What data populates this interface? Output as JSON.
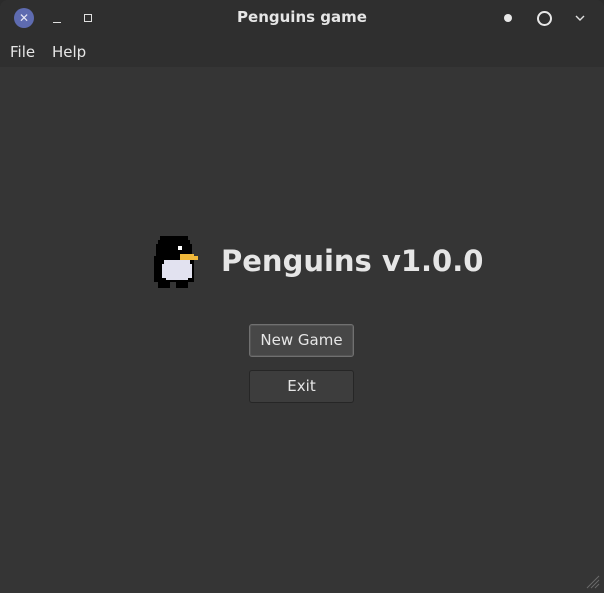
{
  "window": {
    "title": "Penguins game",
    "close_glyph": "✕"
  },
  "menu": {
    "file": "File",
    "help": "Help"
  },
  "main": {
    "app_title": "Penguins v1.0.0",
    "new_game_label": "New Game",
    "exit_label": "Exit"
  },
  "icons": {
    "close": "close-icon",
    "minimize": "minimize-icon",
    "maximize": "maximize-icon",
    "dot": "dot-icon",
    "ring": "ring-icon",
    "chevron": "chevron-down-icon",
    "logo": "penguin-icon",
    "grip": "resize-grip-icon"
  },
  "colors": {
    "window_bg": "#353535",
    "titlebar_bg": "#2f2f2f",
    "close_accent": "#5e6bb0",
    "text": "#e6e6e6"
  }
}
